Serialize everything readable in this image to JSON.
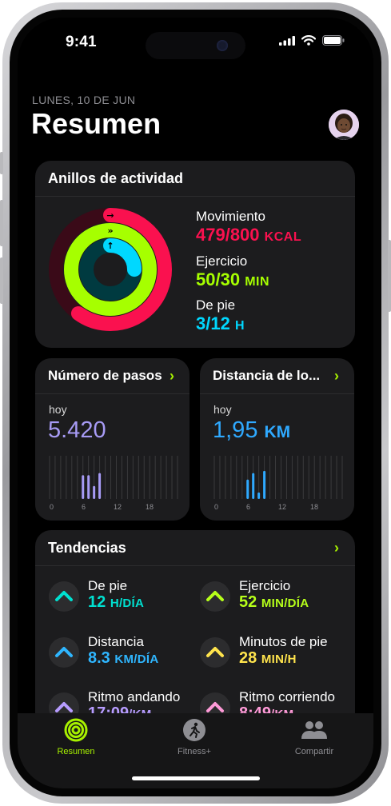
{
  "status_bar": {
    "time": "9:41"
  },
  "header": {
    "date": "LUNES, 10 DE JUN",
    "title": "Resumen"
  },
  "activity_rings": {
    "title": "Anillos de actividad",
    "move": {
      "label": "Movimiento",
      "value": "479/800",
      "unit": "KCAL",
      "color": "#fa114f",
      "progress": 0.6
    },
    "exercise": {
      "label": "Ejercicio",
      "value": "50/30",
      "unit": "MIN",
      "color": "#a6ff00",
      "progress": 1.67
    },
    "stand": {
      "label": "De pie",
      "value": "3/12",
      "unit": "H",
      "color": "#00d8ff",
      "progress": 0.25
    }
  },
  "steps": {
    "title": "Número de pasos",
    "day_label": "hoy",
    "value": "5.420",
    "color": "#a79bf5",
    "axis": [
      "0",
      "6",
      "12",
      "18"
    ]
  },
  "distance": {
    "title": "Distancia de lo...",
    "day_label": "hoy",
    "value": "1,95",
    "unit": "KM",
    "color": "#2fa9ff",
    "axis": [
      "0",
      "6",
      "12",
      "18"
    ]
  },
  "trends": {
    "title": "Tendencias",
    "items": [
      {
        "title": "De pie",
        "value": "12",
        "unit": "H/DÍA",
        "color": "#00e0d0"
      },
      {
        "title": "Ejercicio",
        "value": "52",
        "unit": "MIN/DÍA",
        "color": "#b6ff1a"
      },
      {
        "title": "Distancia",
        "value": "8.3",
        "unit": "KM/DÍA",
        "color": "#2fb6ff"
      },
      {
        "title": "Minutos de pie",
        "value": "28",
        "unit": "MIN/H",
        "color": "#ffe44d"
      },
      {
        "title": "Ritmo andando",
        "value": "17:09",
        "unit": "/KM",
        "color": "#b79cff"
      },
      {
        "title": "Ritmo corriendo",
        "value": "8:49",
        "unit": "/KM",
        "color": "#ff9ad8"
      }
    ]
  },
  "tabbar": {
    "summary": "Resumen",
    "fitness": "Fitness+",
    "sharing": "Compartir",
    "active_color": "#a7f100"
  }
}
